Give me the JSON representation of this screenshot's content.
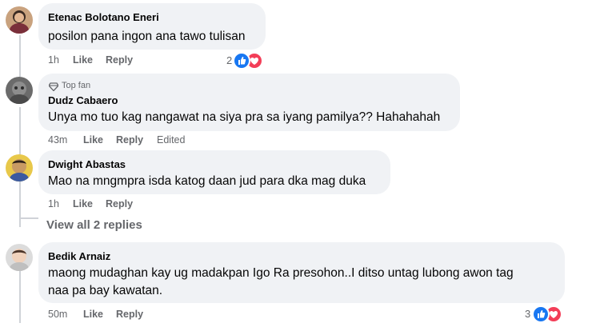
{
  "comments": [
    {
      "author": "Etenac Bolotano Eneri",
      "text": "posilon pana ingon ana tawo tulisan",
      "time": "1h",
      "like": "Like",
      "reply": "Reply",
      "reaction_count": "2",
      "reactions": [
        "like-icon",
        "love-icon"
      ]
    },
    {
      "badge": "Top fan",
      "author": "Dudz Cabaero",
      "text": "Unya mo tuo kag nangawat na siya pra sa iyang pamilya?? Hahahahah",
      "time": "43m",
      "like": "Like",
      "reply": "Reply",
      "edited": "Edited"
    },
    {
      "author": "Dwight Abastas",
      "text": "Mao na mngmpra isda katog daan jud para dka mag duka",
      "time": "1h",
      "like": "Like",
      "reply": "Reply"
    },
    {
      "author": "Bedik Arnaiz",
      "text_line1": "maong mudaghan kay ug madakpan Igo Ra presohon..I ditso untag lubong awon tag",
      "text_line2": "naa pa bay kawatan.",
      "time": "50m",
      "like": "Like",
      "reply": "Reply",
      "reaction_count": "3",
      "reactions": [
        "like-icon",
        "love-icon"
      ]
    }
  ],
  "view_replies": "View all 2 replies",
  "colors": {
    "like": "#1877f2",
    "love": "#f33e58",
    "bubble": "#f0f2f5",
    "meta": "#65676b"
  }
}
